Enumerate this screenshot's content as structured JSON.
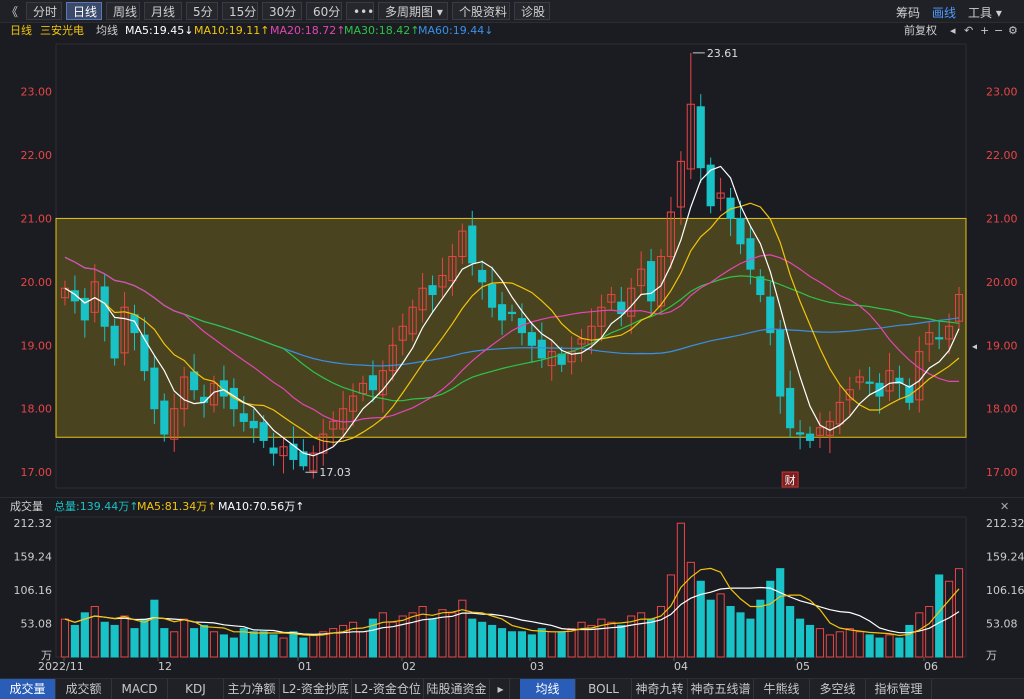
{
  "toolbar": {
    "back_glyph": "《",
    "buttons": [
      "分时",
      "日线",
      "周线",
      "月线",
      "5分",
      "15分",
      "30分",
      "60分",
      "•••",
      "多周期图 ▾",
      "个股资料",
      "诊股"
    ],
    "active_index": 1,
    "right": {
      "chouma": "筹码",
      "huaxian": "画线",
      "gongju": "工具 ▾"
    },
    "window_icons": [
      "▭",
      "✕"
    ]
  },
  "info": {
    "period": "日线",
    "stock_name": "三安光电",
    "ma_label": "均线",
    "ma5": "MA5:19.45↓",
    "ma10": "MA10:19.11↑",
    "ma20": "MA20:18.72↑",
    "ma30": "MA30:18.42↑",
    "ma60": "MA60:19.44↓",
    "fuquan": "前复权",
    "icons": [
      "◂",
      "↶",
      "+",
      "−",
      "⚙"
    ],
    "colors": {
      "ma5": "#ffffff",
      "ma10": "#f2c40c",
      "ma20": "#e346b5",
      "ma30": "#2ec24a",
      "ma60": "#3a8fe8",
      "up": "#e84545",
      "down": "#19c2c6"
    }
  },
  "price_axis": {
    "labels": [
      "23.00",
      "22.00",
      "21.00",
      "20.00",
      "19.00",
      "18.00",
      "17.00"
    ]
  },
  "annotations": {
    "high": "23.61",
    "low": "17.03",
    "cai": "财"
  },
  "volume": {
    "title": "成交量",
    "total": "总量:139.44万↑",
    "ma5": "MA5:81.34万↑",
    "ma10": "MA10:70.56万↑",
    "axis_labels": [
      "212.32",
      "159.24",
      "106.16",
      "53.08",
      "万"
    ]
  },
  "dates": [
    "2022/11",
    "12",
    "01",
    "02",
    "03",
    "04",
    "05",
    "06"
  ],
  "bottom_tabs": {
    "left": [
      "成交量",
      "成交额",
      "MACD",
      "KDJ",
      "主力净额",
      "L2-资金抄底",
      "L2-资金仓位",
      "陆股通资金"
    ],
    "right": [
      "均线",
      "BOLL",
      "神奇九转",
      "神奇五线谱",
      "牛熊线",
      "多空线",
      "指标管理"
    ],
    "nav": "▸"
  },
  "chart_data": {
    "type": "candlestick",
    "y_range": [
      16.75,
      23.75
    ],
    "box": {
      "top": 21.0,
      "bottom": 17.55
    },
    "high_point": 23.61,
    "low_point": 17.03,
    "volume_range": [
      0,
      212.32
    ],
    "closes": [
      19.9,
      19.7,
      19.4,
      20.0,
      19.3,
      18.8,
      19.6,
      19.2,
      18.6,
      18.0,
      17.6,
      18.0,
      18.5,
      18.3,
      18.1,
      18.4,
      18.2,
      18.0,
      17.8,
      17.7,
      17.5,
      17.3,
      17.4,
      17.2,
      17.1,
      17.3,
      17.6,
      17.8,
      18.0,
      18.2,
      18.4,
      18.3,
      18.6,
      19.0,
      19.3,
      19.6,
      19.9,
      19.8,
      20.1,
      20.4,
      20.8,
      20.3,
      20.0,
      19.6,
      19.4,
      19.5,
      19.2,
      19.0,
      18.8,
      18.9,
      18.7,
      18.9,
      19.1,
      19.3,
      19.6,
      19.8,
      19.5,
      19.9,
      20.2,
      19.7,
      20.4,
      21.1,
      21.9,
      22.8,
      21.8,
      21.2,
      21.4,
      21.0,
      20.6,
      20.2,
      19.8,
      19.2,
      18.2,
      17.7,
      17.6,
      17.5,
      17.7,
      17.8,
      18.1,
      18.3,
      18.5,
      18.4,
      18.2,
      18.6,
      18.4,
      18.1,
      18.9,
      19.2,
      19.1,
      19.3,
      19.8
    ],
    "vol": [
      60,
      50,
      70,
      80,
      55,
      50,
      65,
      45,
      60,
      90,
      45,
      40,
      60,
      45,
      50,
      40,
      35,
      30,
      45,
      40,
      40,
      35,
      30,
      40,
      30,
      35,
      40,
      45,
      50,
      55,
      40,
      60,
      70,
      55,
      65,
      70,
      80,
      60,
      75,
      70,
      90,
      60,
      55,
      50,
      45,
      40,
      40,
      35,
      45,
      40,
      40,
      45,
      55,
      50,
      60,
      55,
      50,
      65,
      70,
      60,
      80,
      130,
      212,
      150,
      120,
      90,
      100,
      80,
      70,
      60,
      90,
      120,
      140,
      80,
      60,
      50,
      45,
      35,
      40,
      45,
      40,
      35,
      30,
      35,
      30,
      50,
      70,
      80,
      130,
      120,
      140
    ]
  }
}
